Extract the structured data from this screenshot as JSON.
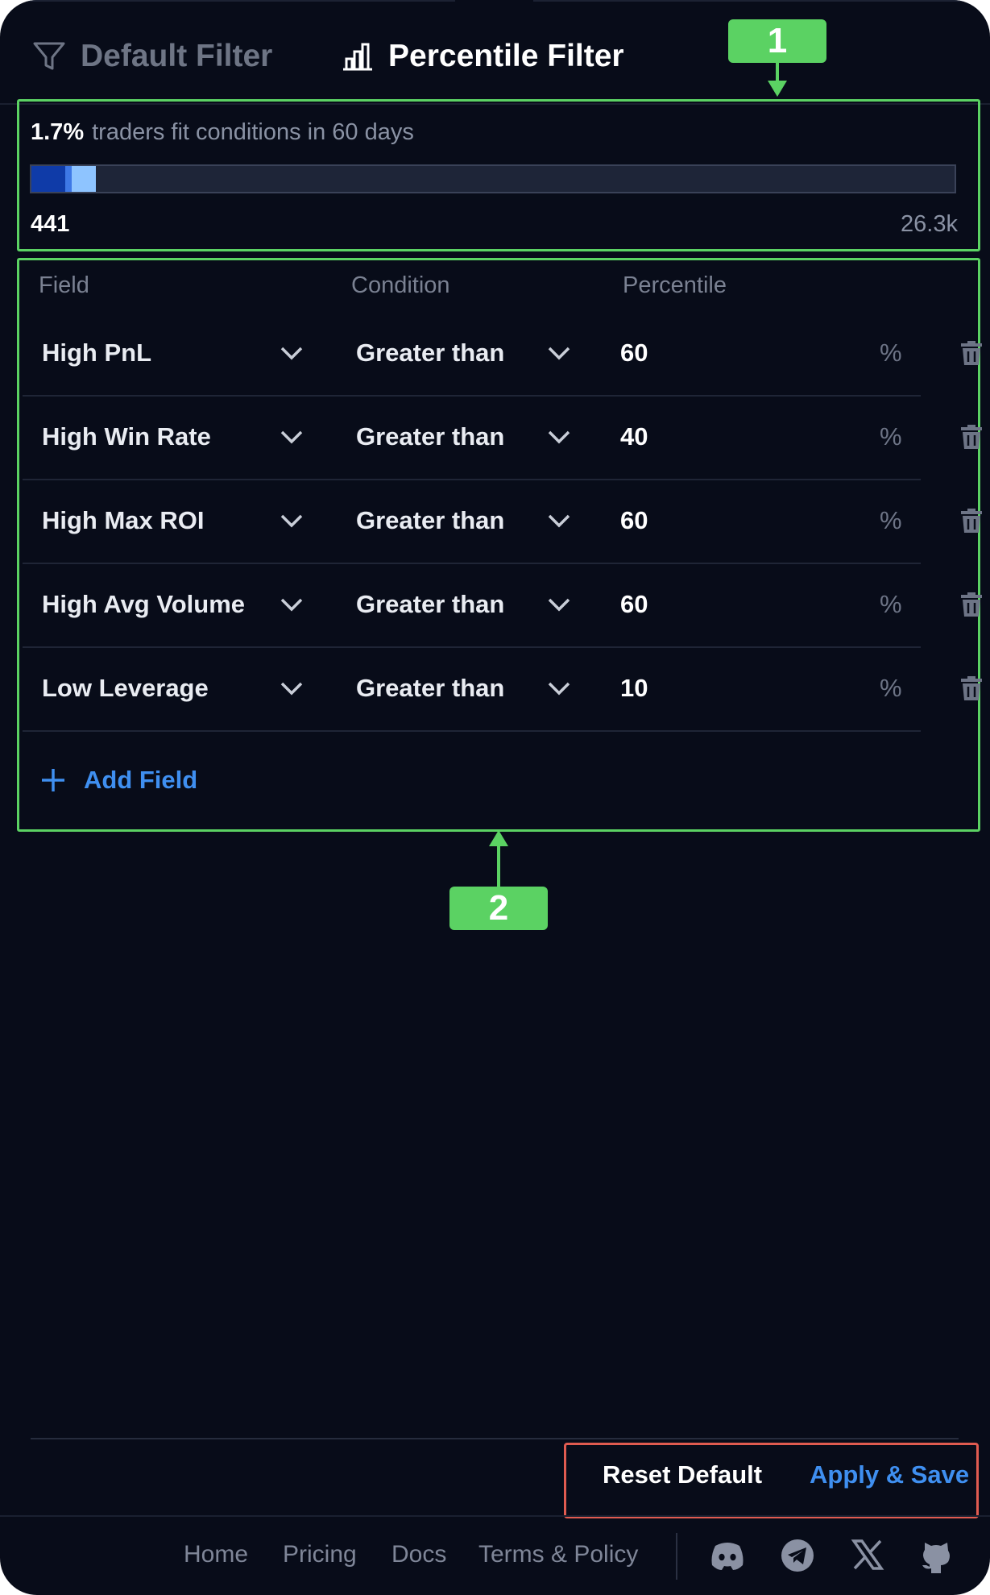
{
  "tabs": {
    "default": "Default Filter",
    "percentile": "Percentile Filter"
  },
  "stats": {
    "percent": "1.7%",
    "text": "traders fit conditions in 60 days",
    "min": "441",
    "max": "26.3k",
    "progress_fraction": 0.017
  },
  "columns": {
    "field": "Field",
    "condition": "Condition",
    "percentile": "Percentile"
  },
  "rows": [
    {
      "field": "High PnL",
      "condition": "Greater than",
      "value": "60",
      "unit": "%"
    },
    {
      "field": "High Win Rate",
      "condition": "Greater than",
      "value": "40",
      "unit": "%"
    },
    {
      "field": "High Max ROI",
      "condition": "Greater than",
      "value": "60",
      "unit": "%"
    },
    {
      "field": "High Avg Volume",
      "condition": "Greater than",
      "value": "60",
      "unit": "%"
    },
    {
      "field": "Low Leverage",
      "condition": "Greater than",
      "value": "10",
      "unit": "%"
    }
  ],
  "add_field": "Add Field",
  "buttons": {
    "reset": "Reset Default",
    "apply": "Apply & Save"
  },
  "footer": {
    "links": [
      "Home",
      "Pricing",
      "Docs",
      "Terms & Policy"
    ],
    "social": [
      "discord-icon",
      "telegram-icon",
      "x-icon",
      "github-icon"
    ]
  },
  "callouts": [
    "1",
    "2"
  ],
  "colors": {
    "background": "#080c19",
    "accent": "#3f8ff0",
    "callout": "#5bd263",
    "highlight": "#e05b50"
  }
}
